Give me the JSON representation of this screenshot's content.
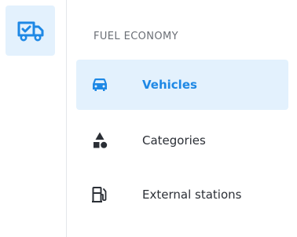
{
  "rail": {
    "items": [
      {
        "icon": "truck-check-icon",
        "active": true
      }
    ]
  },
  "fuel_economy": {
    "section_title": "FUEL ECONOMY",
    "items": [
      {
        "label": "Vehicles",
        "icon": "car-icon",
        "active": true
      },
      {
        "label": "Categories",
        "icon": "shapes-icon",
        "active": false
      },
      {
        "label": "External stations",
        "icon": "gas-station-icon",
        "active": false
      }
    ]
  },
  "colors": {
    "accent": "#1e88e5",
    "active_bg": "#e3f1fd",
    "text": "#2b2f36",
    "muted": "#6b6f76",
    "icon_dark": "#2b2f36"
  }
}
